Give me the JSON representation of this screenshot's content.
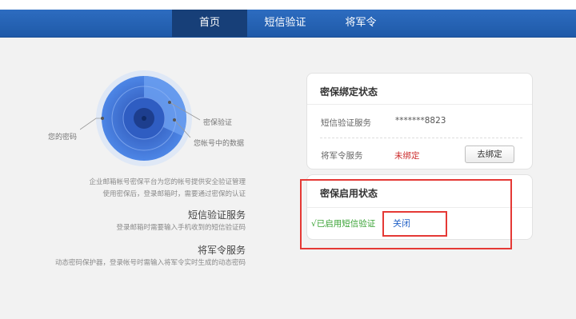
{
  "nav": {
    "items": [
      {
        "label": "首页",
        "active": true
      },
      {
        "label": "短信验证",
        "active": false
      },
      {
        "label": "将军令",
        "active": false
      }
    ]
  },
  "illustration": {
    "label_password": "您的密码",
    "label_verify": "密保验证",
    "label_data": "您帐号中的数据"
  },
  "intro": {
    "line1": "企业邮箱帐号密保平台为您的帐号提供安全验证管理",
    "line2": "使用密保后，登录邮箱时，需要通过密保的认证"
  },
  "services": [
    {
      "title": "短信验证服务",
      "desc": "登录邮箱时需要输入手机收到的短信验证码"
    },
    {
      "title": "将军令服务",
      "desc": "动态密码保护器，登录帐号时需输入将军令实时生成的动态密码"
    }
  ],
  "binding_panel": {
    "title": "密保绑定状态",
    "sms_label": "短信验证服务",
    "sms_value": "*******8823",
    "token_label": "将军令服务",
    "token_value": "未绑定",
    "bind_button": "去绑定"
  },
  "enable_panel": {
    "title": "密保启用状态",
    "status": "√已启用短信验证",
    "close_link": "关闭"
  },
  "colors": {
    "nav_bg": "#1f5aa8",
    "nav_active": "#173f78",
    "unbound_red": "#cc2a2a",
    "enabled_green": "#3aa335",
    "link_blue": "#2463c7",
    "highlight_red": "#e53935"
  }
}
